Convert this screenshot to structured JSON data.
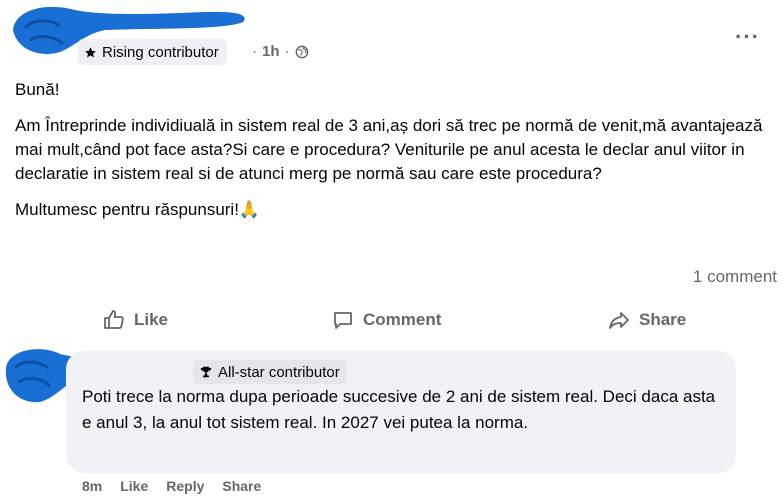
{
  "post": {
    "badge_label": "Rising contributor",
    "time": "1h",
    "dot": "·",
    "greeting": "Bună!",
    "body": "Am Întreprinde individiuală in sistem real de 3 ani,aș dori să trec pe normă de venit,mă avantajează mai mult,când pot face asta?Si care e procedura? Veniturile pe anul acesta le declar anul viitor in declaratie in sistem real si de atunci merg pe normă sau care este procedura?",
    "thanks": "Multumesc pentru răspunsuri!🙏",
    "comment_count": "1 comment",
    "more_label": "···"
  },
  "actions": {
    "like": "Like",
    "comment": "Comment",
    "share": "Share"
  },
  "comment": {
    "badge_label": "All-star contributor",
    "text": "Poti trece la norma dupa perioade succesive de 2 ani de sistem real. Deci daca asta e anul 3, la anul tot sistem real. In 2027 vei putea la norma.",
    "time": "8m",
    "like": "Like",
    "reply": "Reply",
    "share": "Share"
  },
  "colors": {
    "redaction": "#1a6fd4",
    "secondary_text": "#65676b",
    "bubble": "#f0f2f5"
  }
}
